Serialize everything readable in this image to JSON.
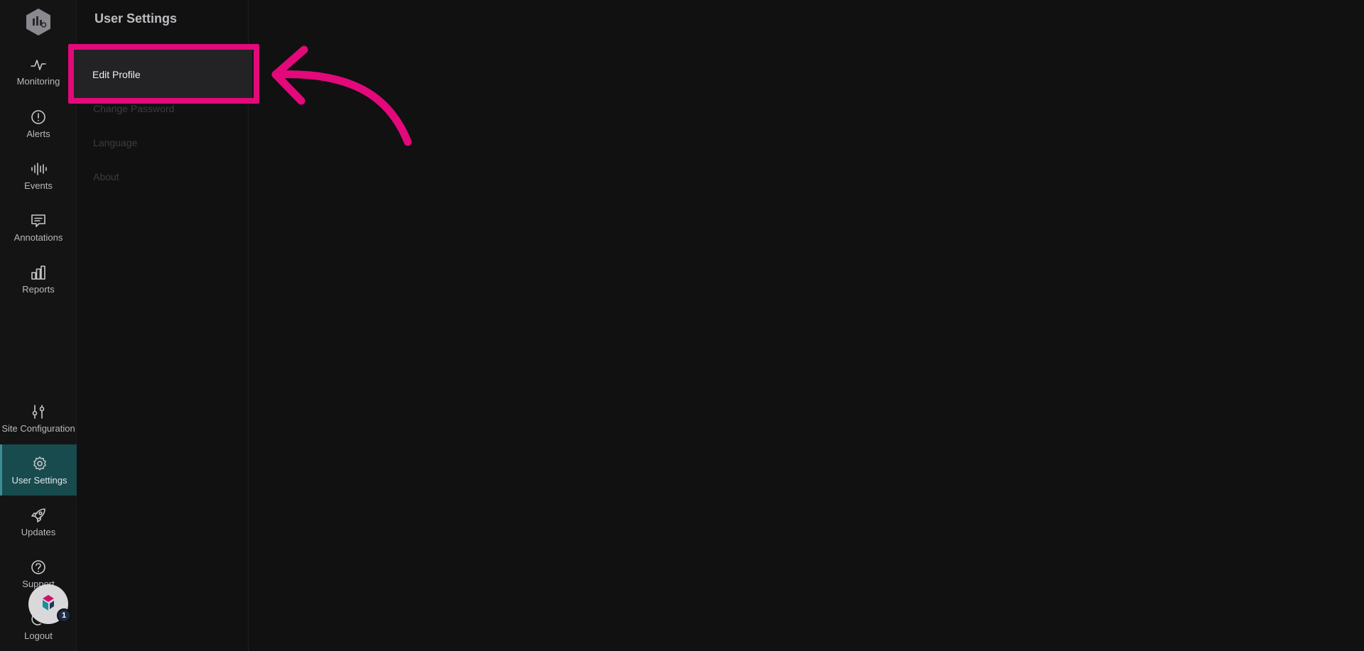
{
  "header": {
    "title": "User Settings"
  },
  "nav": {
    "monitoring": "Monitoring",
    "alerts": "Alerts",
    "events": "Events",
    "annotations": "Annotations",
    "reports": "Reports",
    "site_configuration": "Site Configuration",
    "user_settings": "User Settings",
    "updates": "Updates",
    "support": "Support",
    "logout": "Logout"
  },
  "settings_menu": {
    "edit_profile": "Edit Profile",
    "change_password": "Change Password",
    "language": "Language",
    "about": "About"
  },
  "widget": {
    "badge_count": "1"
  },
  "colors": {
    "accent": "#184b4e",
    "highlight": "#e3097a"
  }
}
